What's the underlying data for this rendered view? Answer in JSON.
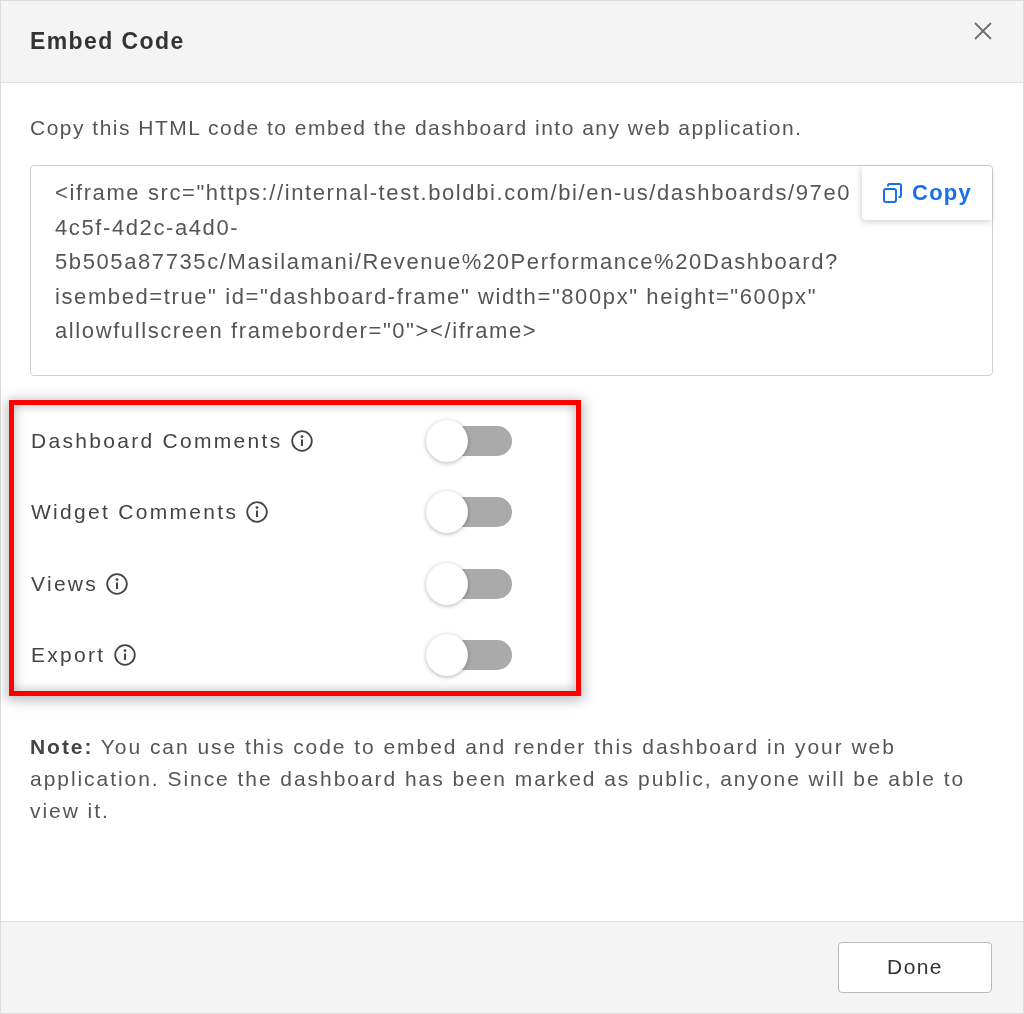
{
  "dialog": {
    "title": "Embed Code"
  },
  "description": "Copy this HTML code to embed the dashboard into any web application.",
  "code": {
    "text": "<iframe src=\"https://internal-test.boldbi.com/bi/en-us/dashboards/97e0\n4c5f-4d2c-a4d0-\n5b505a87735c/Masilamani/Revenue%20Performance%20Dashboard?\nisembed=true\" id=\"dashboard-frame\" width=\"800px\" height=\"600px\"\nallowfullscreen frameborder=\"0\"></iframe>",
    "copy_button": "Copy"
  },
  "toggles": [
    {
      "label": "Dashboard Comments",
      "on": false
    },
    {
      "label": "Widget Comments",
      "on": false
    },
    {
      "label": "Views",
      "on": false
    },
    {
      "label": "Export",
      "on": false
    }
  ],
  "note": "**Note:** You can use this code to embed and render this dashboard in your web application. Since the dashboard has been marked as public, anyone will be able to view it.",
  "footer": {
    "done_button": "Done"
  }
}
